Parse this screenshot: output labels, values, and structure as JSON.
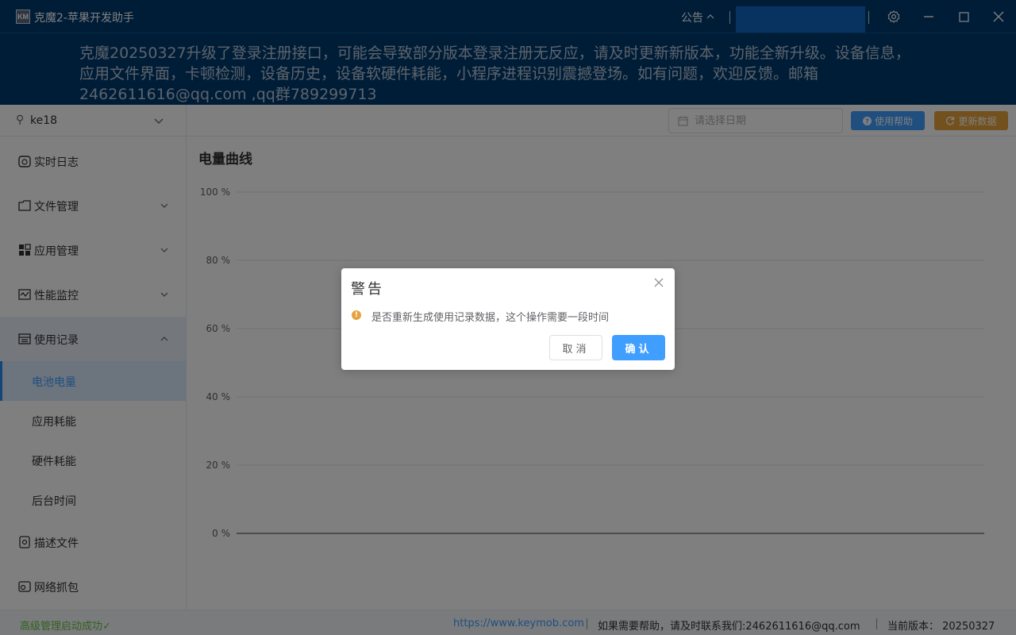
{
  "window": {
    "logo_text": "KM",
    "title": "克魔2-苹果开发助手",
    "notice_label": "公告",
    "accent_color": "#003a6e"
  },
  "announcement": {
    "text": "克魔20250327升级了登录注册接口，可能会导致部分版本登录注册无反应，请及时更新新版本，功能全新升级。设备信息，应用文件界面，卡顿检测，设备历史，设备软硬件耗能，小程序进程识别震撼登场。如有问题，欢迎反馈。邮箱2462611616@qq.com ,qq群789299713"
  },
  "sidebar": {
    "device": "ke18",
    "menu": {
      "realtime_log": "实时日志",
      "file_manage": "文件管理",
      "app_manage": "应用管理",
      "perf_monitor": "性能监控",
      "usage_records": "使用记录",
      "battery": "电池电量",
      "app_energy": "应用耗能",
      "hw_energy": "硬件耗能",
      "bg_time": "后台时间",
      "profile": "描述文件",
      "network_capture": "网络抓包"
    }
  },
  "toolbar": {
    "date_placeholder": "请选择日期",
    "help_label": "使用帮助",
    "update_label": "更新数据"
  },
  "chart_data": {
    "type": "line",
    "title": "电量曲线",
    "ylim": [
      0,
      100
    ],
    "yticks": [
      "100 %",
      "80 %",
      "60 %",
      "40 %",
      "20 %",
      "0 %"
    ],
    "ytick_values": [
      100,
      80,
      60,
      40,
      20,
      0
    ],
    "series": [],
    "grid": true
  },
  "statusbar": {
    "status": "高级管理启动成功✓",
    "link": "https://www.keymob.com",
    "contact": "如果需要帮助，请及时联系我们:2462611616@qq.com",
    "version": "当前版本：  20250327"
  },
  "dialog": {
    "title": "警告",
    "message": "是否重新生成使用记录数据，这个操作需要一段时间",
    "cancel": "取消",
    "confirm": "确认"
  }
}
